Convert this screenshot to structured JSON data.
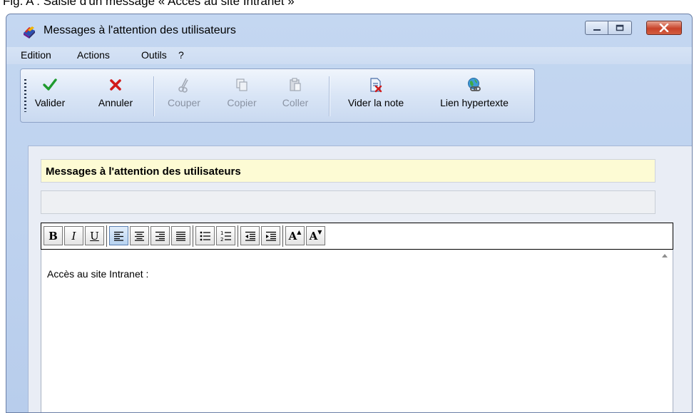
{
  "caption": "Fig. A : Saisie d'un message « Accès au site Intranet »",
  "window": {
    "title": "Messages à l'attention des utilisateurs",
    "controls": {
      "minimize": "—",
      "maximize": "☐",
      "close": "✕"
    }
  },
  "menu": [
    "Edition",
    "Actions",
    "Outils",
    "?"
  ],
  "toolbar": {
    "validate": "Valider",
    "cancel": "Annuler",
    "cut": "Couper",
    "copy": "Copier",
    "paste": "Coller",
    "clear_note": "Vider la note",
    "hyperlink": "Lien hypertexte"
  },
  "form": {
    "subject": "Messages à l'attention des utilisateurs",
    "second_field": ""
  },
  "format_toolbar": {
    "bold": "B",
    "italic": "I",
    "underline": "U",
    "font_up": "A",
    "font_down": "A"
  },
  "editor": {
    "text": "Accès au site Intranet :"
  },
  "colors": {
    "window_bg": "#c4d7f1",
    "subject_bg": "#fdfbd4",
    "validate_green": "#1f9a2e",
    "cancel_red": "#d11a1a",
    "close_red": "#c8432a"
  }
}
